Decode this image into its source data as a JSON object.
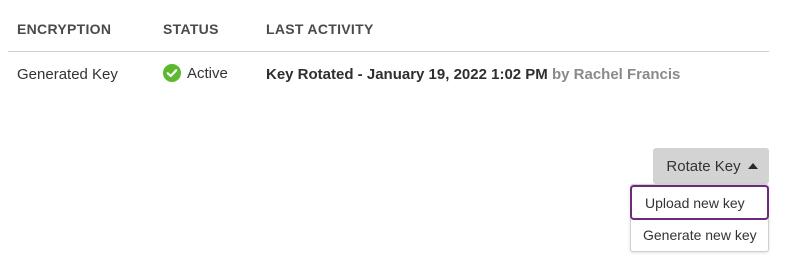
{
  "table": {
    "headers": {
      "encryption": "ENCRYPTION",
      "status": "STATUS",
      "last_activity": "LAST ACTIVITY"
    },
    "row": {
      "encryption": "Generated Key",
      "status": "Active",
      "status_icon": "check-circle-icon",
      "status_color": "#5cb82e",
      "activity_main": "Key Rotated - January 19, 2022 1:02 PM",
      "activity_by": "by Rachel Francis"
    }
  },
  "rotate": {
    "label": "Rotate Key",
    "icon": "caret-up-icon"
  },
  "menu": {
    "items": [
      {
        "label": "Upload new key"
      },
      {
        "label": "Generate new key"
      }
    ],
    "focus_color": "#6b2a7e"
  }
}
